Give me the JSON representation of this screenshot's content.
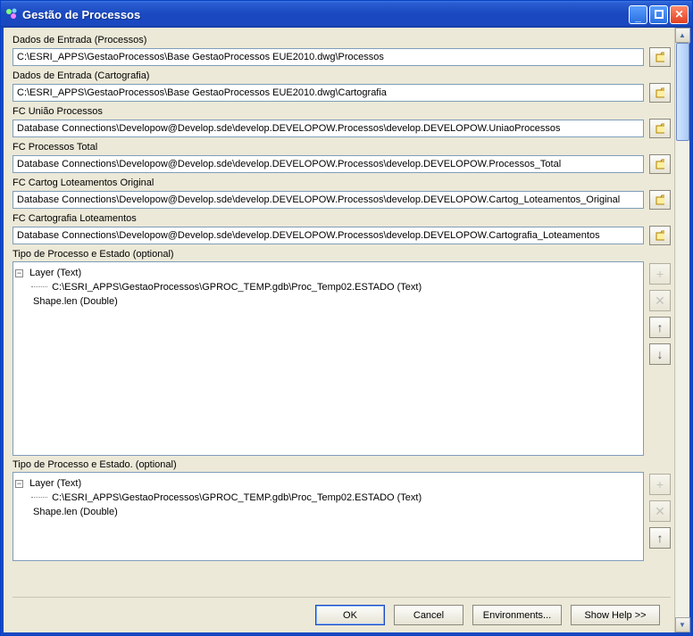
{
  "window": {
    "title": "Gestão de Processos"
  },
  "fields": {
    "dados_processos": {
      "label": "Dados de Entrada (Processos)",
      "value": "C:\\ESRI_APPS\\GestaoProcessos\\Base GestaoProcessos EUE2010.dwg\\Processos"
    },
    "dados_cartografia": {
      "label": "Dados de Entrada (Cartografia)",
      "value": "C:\\ESRI_APPS\\GestaoProcessos\\Base GestaoProcessos EUE2010.dwg\\Cartografia"
    },
    "fc_uniao": {
      "label": "FC União Processos",
      "value": "Database Connections\\Developow@Develop.sde\\develop.DEVELOPOW.Processos\\develop.DEVELOPOW.UniaoProcessos"
    },
    "fc_total": {
      "label": "FC Processos Total",
      "value": "Database Connections\\Developow@Develop.sde\\develop.DEVELOPOW.Processos\\develop.DEVELOPOW.Processos_Total"
    },
    "fc_cartog_orig": {
      "label": "FC Cartog Loteamentos Original",
      "value": "Database Connections\\Developow@Develop.sde\\develop.DEVELOPOW.Processos\\develop.DEVELOPOW.Cartog_Loteamentos_Original"
    },
    "fc_cartografia_lot": {
      "label": "FC Cartografia Loteamentos",
      "value": "Database Connections\\Developow@Develop.sde\\develop.DEVELOPOW.Processos\\develop.DEVELOPOW.Cartografia_Loteamentos"
    }
  },
  "tree1": {
    "label": "Tipo de Processo e Estado (optional)",
    "root": "Layer (Text)",
    "child": "C:\\ESRI_APPS\\GestaoProcessos\\GPROC_TEMP.gdb\\Proc_Temp02.ESTADO (Text)",
    "sibling": "Shape.len (Double)"
  },
  "tree2": {
    "label": "Tipo de Processo e Estado. (optional)",
    "root": "Layer (Text)",
    "child": "C:\\ESRI_APPS\\GestaoProcessos\\GPROC_TEMP.gdb\\Proc_Temp02.ESTADO (Text)",
    "sibling": "Shape.len (Double)"
  },
  "buttons": {
    "ok": "OK",
    "cancel": "Cancel",
    "env": "Environments...",
    "help": "Show Help >>"
  },
  "glyphs": {
    "minus": "−",
    "plus": "+",
    "x": "✕",
    "up": "↑",
    "down": "↓",
    "tri_up": "▲",
    "tri_down": "▼",
    "min_line": "__",
    "max_box": "□",
    "close_x": "✕"
  }
}
